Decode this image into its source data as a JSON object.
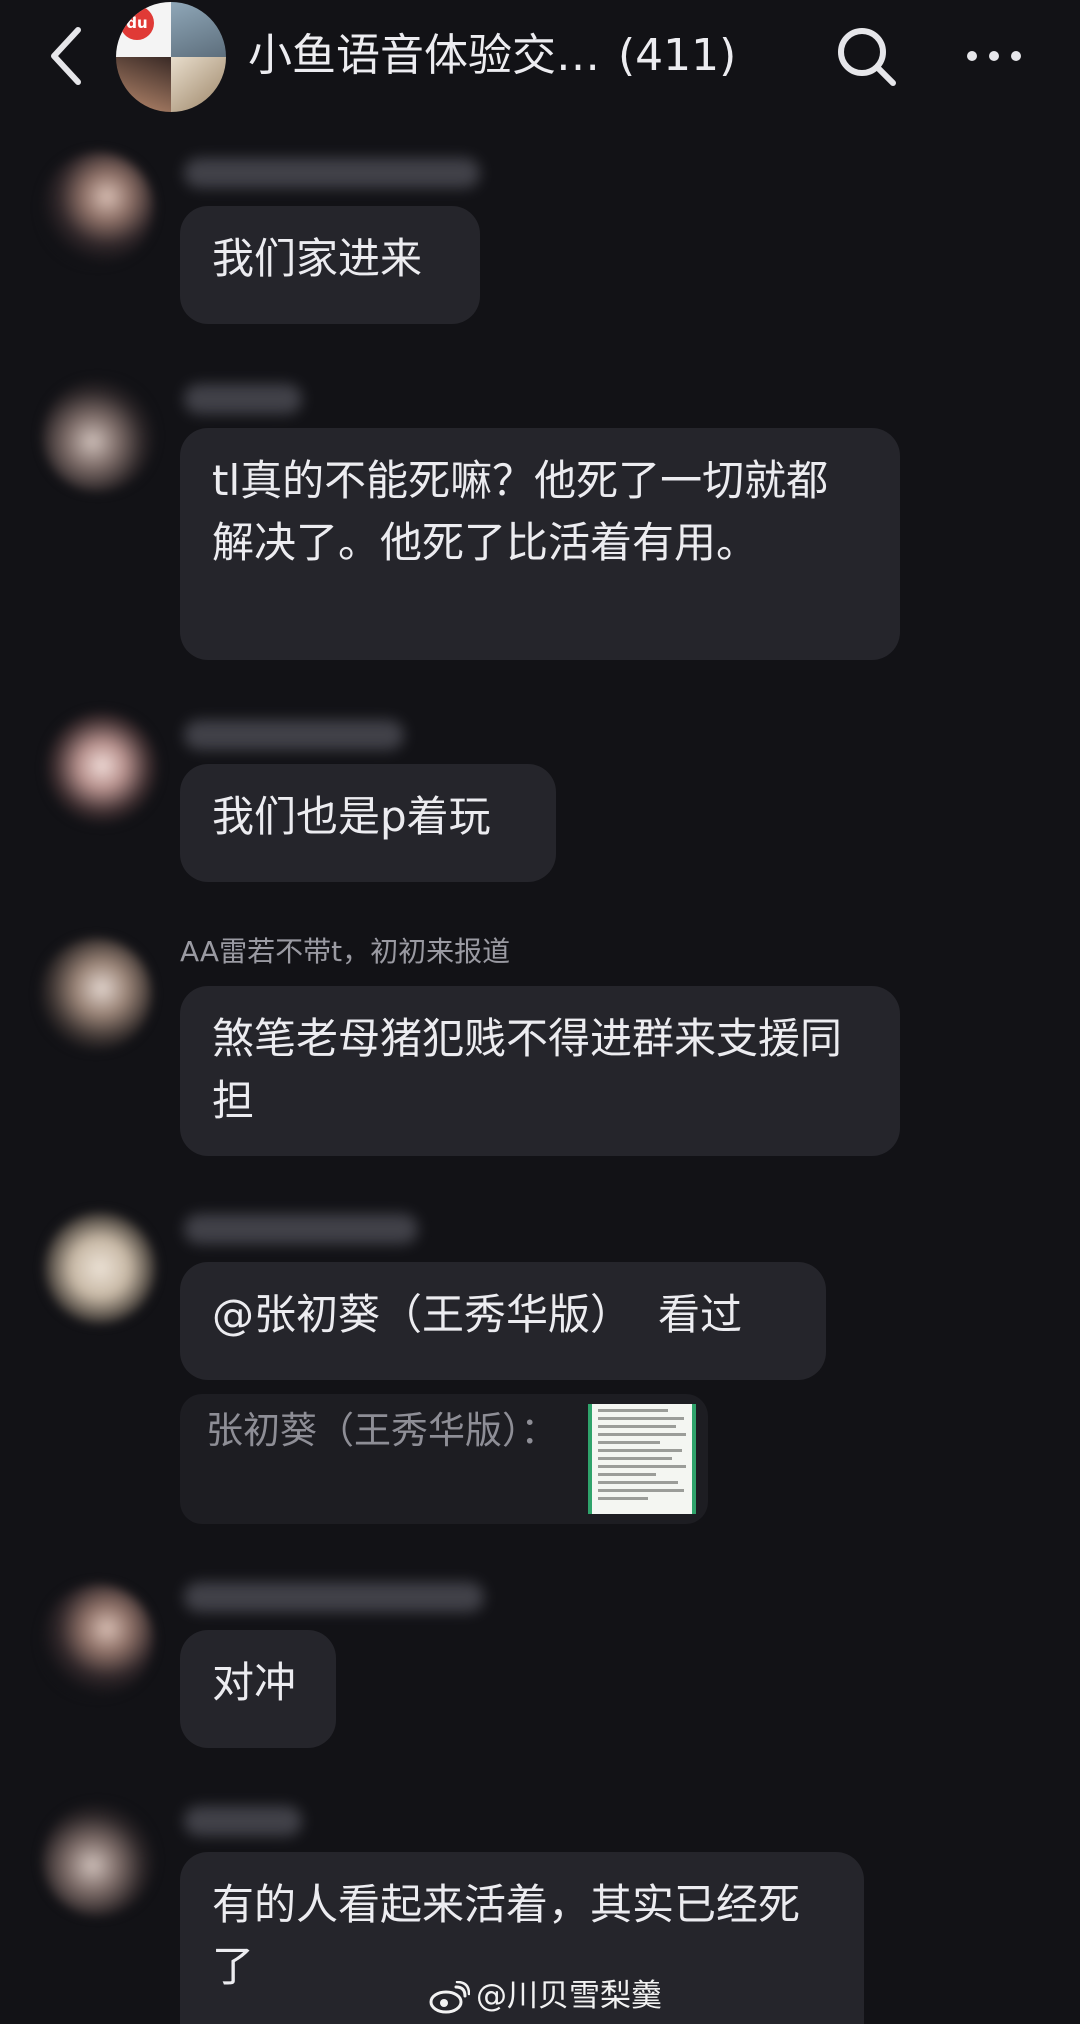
{
  "header": {
    "title": "小鱼语音体验交…",
    "member_count": "(411)",
    "avatar_badge": "du",
    "icons": [
      "back-arrow-icon",
      "search-icon",
      "more-icon"
    ]
  },
  "messages": [
    {
      "sender": "",
      "text": "我们家进来"
    },
    {
      "sender": "",
      "text": "tl真的不能死嘛？他死了一切就都解决了。他死了比活着有用。"
    },
    {
      "sender": "",
      "text": "我们也是p着玩"
    },
    {
      "sender": "AA雷若不带t，初初来报道",
      "text": "煞笔老母猪犯贱不得进群来支援同担"
    },
    {
      "sender": "",
      "mention": "@张初葵（王秀华版）",
      "text": "看过",
      "quote": "张初葵（王秀华版）："
    },
    {
      "sender": "",
      "text": "对冲"
    },
    {
      "sender": "",
      "text": "有的人看起来活着，其实已经死了"
    }
  ],
  "watermark": "@川贝雪梨羹",
  "colors": {
    "background": "#121216",
    "bubble": "#25252b",
    "text": "#ececf0",
    "secondary_text": "#9a9aa2"
  }
}
